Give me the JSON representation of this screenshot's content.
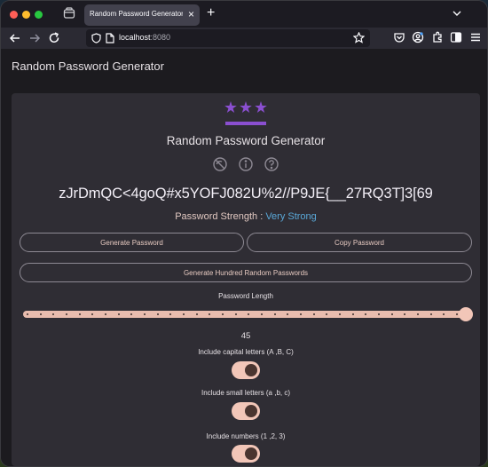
{
  "browser": {
    "tab": {
      "title": "Random Password Generator",
      "close": "×"
    },
    "new_tab": "+",
    "url": {
      "host": "localhost",
      "port": ":8080"
    }
  },
  "app": {
    "appbar_title": "Random Password Generator",
    "logo_text": "***",
    "card_title": "Random Password Generator",
    "icons": [
      "sync-disabled-icon",
      "info-icon",
      "help-icon"
    ],
    "password": "zJrDmQC<4goQ#x5YOFJ082U%2//P9JE{__27RQ3T]3[69",
    "strength": {
      "label": "Password Strength : ",
      "value": "Very Strong",
      "value_color": "#5aa8d8"
    },
    "buttons": {
      "generate": "Generate Password",
      "copy": "Copy Password",
      "generate_hundred": "Generate Hundred Random Passwords"
    },
    "length": {
      "label": "Password Length",
      "value": "45"
    },
    "options": [
      {
        "label": "Include capital letters (A ,B, C)",
        "checked": true
      },
      {
        "label": "Include small letters (a ,b, c)",
        "checked": true
      },
      {
        "label": "Include numbers (1 ,2, 3)",
        "checked": true
      }
    ],
    "accent": "#f2c6b8"
  }
}
